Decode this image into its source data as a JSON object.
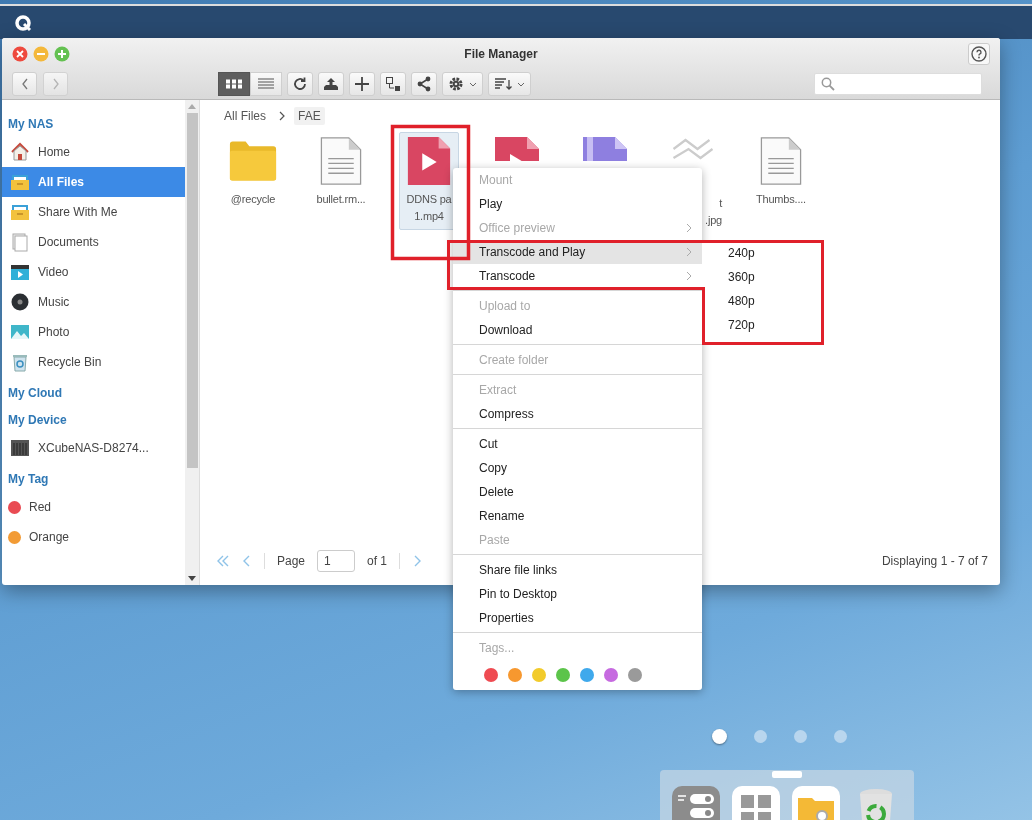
{
  "window": {
    "title": "File Manager"
  },
  "toolbar": {
    "view_modes": [
      {
        "selected": true
      },
      {
        "selected": false
      }
    ]
  },
  "breadcrumb": [
    {
      "label": "All Files",
      "current": false
    },
    {
      "label": "FAE",
      "current": true
    }
  ],
  "sidebar": [
    {
      "title": "My NAS",
      "items": [
        {
          "label": "Home",
          "selected": false
        },
        {
          "label": "All Files",
          "selected": true
        },
        {
          "label": "Share With Me",
          "selected": false
        },
        {
          "label": "Documents",
          "selected": false
        },
        {
          "label": "Video",
          "selected": false
        },
        {
          "label": "Music",
          "selected": false
        },
        {
          "label": "Photo",
          "selected": false
        },
        {
          "label": "Recycle Bin",
          "selected": false
        }
      ]
    },
    {
      "title": "My Cloud"
    },
    {
      "title": "My Device",
      "items": [
        {
          "label": "XCubeNAS-D8274...",
          "selected": false
        }
      ]
    },
    {
      "title": "My Tag",
      "items": [
        {
          "label": "Red",
          "selected": false,
          "color": "#e94b53"
        },
        {
          "label": "Orange",
          "selected": false,
          "color": "#f29b35"
        }
      ]
    }
  ],
  "files": [
    {
      "kind": "folder",
      "name": [
        "@recycle"
      ],
      "selected": false,
      "partly_hidden": false
    },
    {
      "kind": "document",
      "name": [
        "bullet.rm..."
      ],
      "selected": false,
      "partly_hidden": false
    },
    {
      "kind": "video",
      "name": [
        "DDNS pa",
        "1.mp4"
      ],
      "selected": true,
      "partly_hidden": false
    },
    {
      "kind": "video",
      "selected": false,
      "partly_hidden": true
    },
    {
      "kind": "archive",
      "selected": false,
      "partly_hidden": true
    },
    {
      "kind": "image",
      "name": [
        "t",
        ".jpg"
      ],
      "selected": false,
      "partly_hidden": true
    },
    {
      "kind": "document",
      "name": [
        "Thumbs...."
      ],
      "selected": false,
      "partly_hidden": false
    }
  ],
  "pagination": {
    "page_label": "Page",
    "page": "1",
    "of_label": "of 1",
    "status": "Displaying 1 - 7 of 7"
  },
  "context_menu": [
    {
      "kind": "item",
      "label": "Mount",
      "disabled": true,
      "submenu": false,
      "highlighted": false
    },
    {
      "kind": "item",
      "label": "Play",
      "disabled": false,
      "submenu": false,
      "highlighted": false
    },
    {
      "kind": "item",
      "label": "Office preview",
      "disabled": true,
      "submenu": true,
      "highlighted": false
    },
    {
      "kind": "item",
      "label": "Transcode and Play",
      "disabled": false,
      "submenu": true,
      "highlighted": true
    },
    {
      "kind": "item",
      "label": "Transcode",
      "disabled": false,
      "submenu": true,
      "highlighted": false
    },
    {
      "kind": "separator"
    },
    {
      "kind": "item",
      "label": "Upload to",
      "disabled": true,
      "submenu": false,
      "highlighted": false
    },
    {
      "kind": "item",
      "label": "Download",
      "disabled": false,
      "submenu": false,
      "highlighted": false
    },
    {
      "kind": "separator"
    },
    {
      "kind": "item",
      "label": "Create folder",
      "disabled": true,
      "submenu": false,
      "highlighted": false
    },
    {
      "kind": "separator"
    },
    {
      "kind": "item",
      "label": "Extract",
      "disabled": true,
      "submenu": false,
      "highlighted": false
    },
    {
      "kind": "item",
      "label": "Compress",
      "disabled": false,
      "submenu": false,
      "highlighted": false
    },
    {
      "kind": "separator"
    },
    {
      "kind": "item",
      "label": "Cut",
      "disabled": false,
      "submenu": false,
      "highlighted": false
    },
    {
      "kind": "item",
      "label": "Copy",
      "disabled": false,
      "submenu": false,
      "highlighted": false
    },
    {
      "kind": "item",
      "label": "Delete",
      "disabled": false,
      "submenu": false,
      "highlighted": false
    },
    {
      "kind": "item",
      "label": "Rename",
      "disabled": false,
      "submenu": false,
      "highlighted": false
    },
    {
      "kind": "item",
      "label": "Paste",
      "disabled": true,
      "submenu": false,
      "highlighted": false
    },
    {
      "kind": "separator"
    },
    {
      "kind": "item",
      "label": "Share file links",
      "disabled": false,
      "submenu": false,
      "highlighted": false
    },
    {
      "kind": "item",
      "label": "Pin to Desktop",
      "disabled": false,
      "submenu": false,
      "highlighted": false
    },
    {
      "kind": "item",
      "label": "Properties",
      "disabled": false,
      "submenu": false,
      "highlighted": false
    },
    {
      "kind": "separator"
    },
    {
      "kind": "item",
      "label": "Tags...",
      "disabled": true,
      "submenu": false,
      "highlighted": false
    },
    {
      "kind": "colors",
      "tags": [
        {
          "color": "#ef4b52"
        },
        {
          "color": "#f7982f"
        },
        {
          "color": "#f2cb2b"
        },
        {
          "color": "#5cc44a"
        },
        {
          "color": "#3fa9ec"
        },
        {
          "color": "#c66ae0"
        },
        {
          "color": "#9a9a9a"
        }
      ]
    }
  ],
  "submenu": [
    "240p",
    "360p",
    "480p",
    "720p"
  ],
  "desktop": {
    "page_dots": [
      {
        "selected": true
      },
      {
        "selected": false
      },
      {
        "selected": false
      },
      {
        "selected": false
      }
    ]
  }
}
